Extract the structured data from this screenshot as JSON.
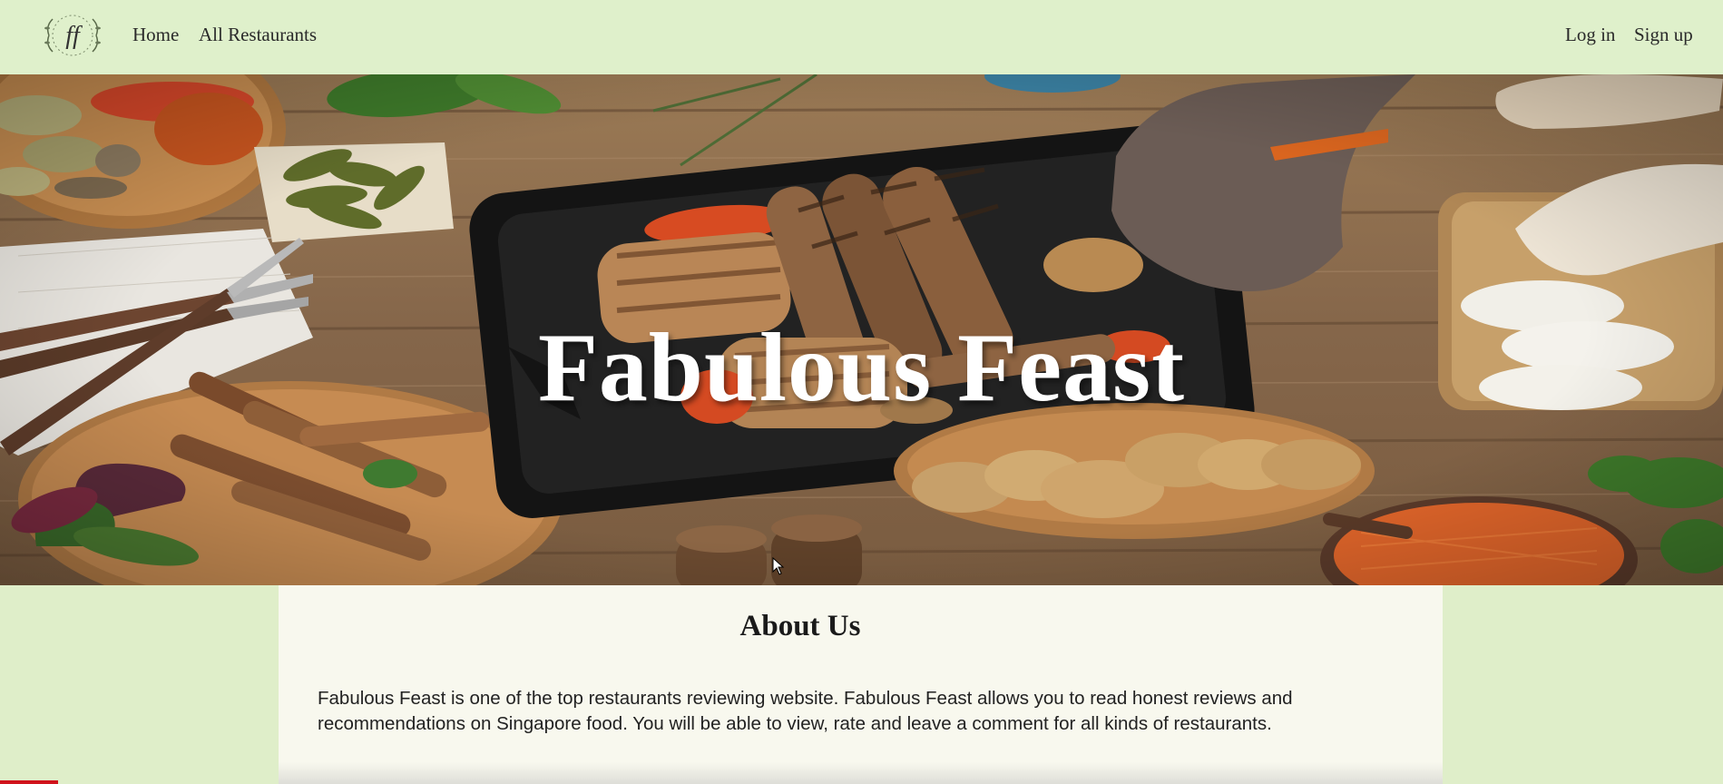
{
  "nav": {
    "home": "Home",
    "all_restaurants": "All Restaurants",
    "login": "Log in",
    "signup": "Sign up",
    "logo_icon": "ff-monogram-logo-icon"
  },
  "hero": {
    "title": "Fabulous Feast",
    "image": "grilled-food-table-photo"
  },
  "about": {
    "title": "About Us",
    "line1": "Fabulous Feast is one of the top restaurants reviewing website. Fabulous Feast allows you to read honest reviews and",
    "line2": "recommendations on Singapore food. You will be able to view, rate and leave a comment for all kinds of restaurants."
  },
  "colors": {
    "nav_bg": "#dff0cb",
    "page_bg": "#dfeec9",
    "panel_bg": "#f8f8ee",
    "hero_title": "#ffffff"
  }
}
